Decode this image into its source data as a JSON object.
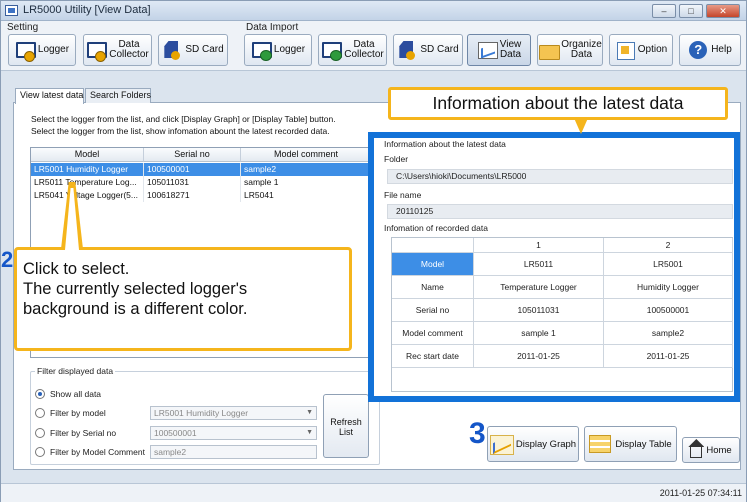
{
  "window": {
    "title": "LR5000 Utility [View Data]"
  },
  "toolbar": {
    "setting_label": "Setting",
    "import_label": "Data Import",
    "buttons": [
      {
        "label": "Logger",
        "icon": "logger-icon"
      },
      {
        "label": "Data\nCollector",
        "icon": "data-collector-icon"
      },
      {
        "label": "SD Card",
        "icon": "sd-card-icon"
      },
      {
        "label": "Logger",
        "icon": "logger-import-icon"
      },
      {
        "label": "Data\nCollector",
        "icon": "data-collector-import-icon"
      },
      {
        "label": "SD Card",
        "icon": "sd-card-import-icon"
      },
      {
        "label": "View\nData",
        "icon": "view-data-icon"
      },
      {
        "label": "Organize\nData",
        "icon": "folder-icon"
      },
      {
        "label": "Option",
        "icon": "option-icon"
      },
      {
        "label": "Help",
        "icon": "help-icon"
      }
    ]
  },
  "tabs": [
    "View latest data",
    "Search Folders"
  ],
  "instructions": [
    "Select the logger from the list, and click [Display Graph] or [Display Table] button.",
    "Select the logger from the list, show infomation abount the latest recorded data."
  ],
  "logger_list": {
    "columns": [
      "Model",
      "Serial no",
      "Model comment"
    ],
    "rows": [
      {
        "model": "LR5001 Humidity Logger",
        "serial": "100500001",
        "comment": "sample2",
        "selected": true
      },
      {
        "model": "LR5011 Temperature Log...",
        "serial": "105011031",
        "comment": "sample 1",
        "selected": false
      },
      {
        "model": "LR5041 Voltage Logger(5...",
        "serial": "100618271",
        "comment": "LR5041",
        "selected": false
      }
    ]
  },
  "filter": {
    "group_label": "Filter displayed data",
    "options": [
      {
        "label": "Show all data",
        "checked": true
      },
      {
        "label": "Filter by model",
        "checked": false,
        "value": "LR5001 Humidity Logger"
      },
      {
        "label": "Filter by Serial no",
        "checked": false,
        "value": "100500001"
      },
      {
        "label": "Filter by Model Comment",
        "checked": false,
        "value": "sample2"
      }
    ],
    "refresh_label": "Refresh\nList"
  },
  "info": {
    "header": "Information about the latest data",
    "folder_label": "Folder",
    "folder_value": "C:\\Users\\hioki\\Documents\\LR5000",
    "filename_label": "File name",
    "filename_value": "20110125",
    "recorded_label": "Infomation of recorded data",
    "table": {
      "columns": [
        "",
        "1",
        "2"
      ],
      "rows": [
        {
          "label": "Model",
          "values": [
            "LR5011",
            "LR5001"
          ]
        },
        {
          "label": "Name",
          "values": [
            "Temperature Logger",
            "Humidity Logger"
          ]
        },
        {
          "label": "Serial no",
          "values": [
            "105011031",
            "100500001"
          ]
        },
        {
          "label": "Model comment",
          "values": [
            "sample 1",
            "sample2"
          ]
        },
        {
          "label": "Rec start date",
          "values": [
            "2011-01-25",
            "2011-01-25"
          ]
        }
      ]
    }
  },
  "callouts": {
    "info": "Information about the latest data",
    "select_step": "2",
    "select_line1": "Click to select.",
    "select_line2": "The currently selected logger's",
    "select_line3": "background is a different color.",
    "graph_step": "3"
  },
  "bottom_buttons": {
    "graph": "Display Graph",
    "table": "Display Table",
    "home": "Home"
  },
  "status": {
    "timestamp": "2011-01-25 07:34:11"
  },
  "colors": {
    "highlight_border": "#1272d8",
    "callout_border": "#f5b51c",
    "selection": "#3d8ee6"
  }
}
